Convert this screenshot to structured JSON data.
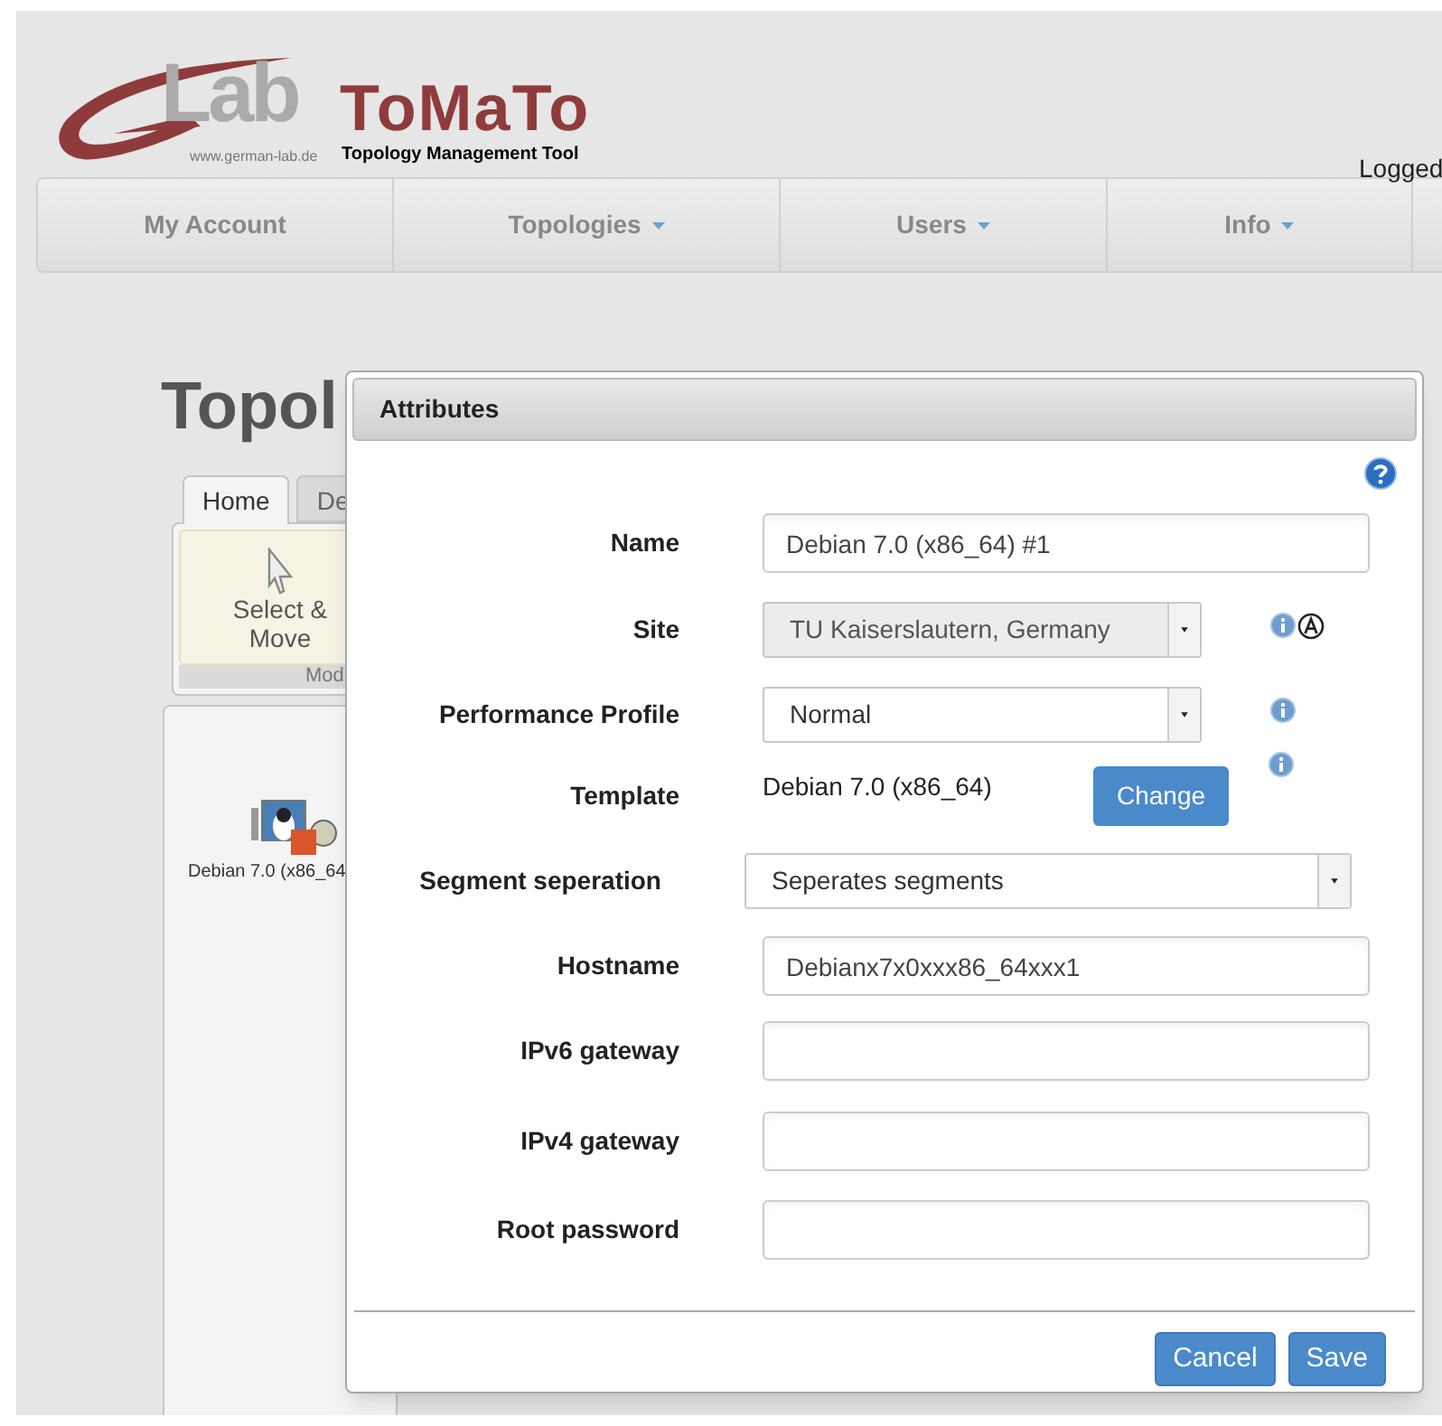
{
  "header": {
    "logo_text": "Lab",
    "logo_url": "www.german-lab.de",
    "app_title": "ToMaTo",
    "app_subtitle": "Topology Management Tool",
    "login_text": "Logged"
  },
  "nav": [
    {
      "label": "My Account",
      "dropdown": false
    },
    {
      "label": "Topologies",
      "dropdown": true
    },
    {
      "label": "Users",
      "dropdown": true
    },
    {
      "label": "Info",
      "dropdown": true
    }
  ],
  "page_title": "Topol",
  "editor_tabs": [
    {
      "label": "Home",
      "selected": true
    },
    {
      "label": "De",
      "selected": false
    }
  ],
  "toolbar": {
    "button": "Select & Move",
    "group_label": "Mod"
  },
  "canvas_node": {
    "label": "Debian 7.0 (x86_64"
  },
  "dialog": {
    "title": "Attributes",
    "fields": [
      {
        "kind": "text",
        "label": "Name",
        "value": "Debian 7.0 (x86_64) #1"
      },
      {
        "kind": "select",
        "label": "Site",
        "value": "TU Kaiserslautern, Germany",
        "disabled": true,
        "wide": false,
        "info": true,
        "auto": true
      },
      {
        "kind": "select",
        "label": "Performance Profile",
        "value": "Normal",
        "disabled": false,
        "wide": false,
        "info": true,
        "auto": false
      },
      {
        "kind": "static",
        "label": "Template",
        "value": "Debian 7.0 (x86_64)",
        "button": "Change",
        "info": true
      },
      {
        "kind": "select",
        "label": "Segment seperation",
        "value": "Seperates segments",
        "disabled": false,
        "wide": true,
        "info": false,
        "auto": false
      },
      {
        "kind": "text",
        "label": "Hostname",
        "value": "Debianx7x0xxx86_64xxx1"
      },
      {
        "kind": "text",
        "label": "IPv6 gateway"
      },
      {
        "kind": "text",
        "label": "IPv4 gateway"
      },
      {
        "kind": "text",
        "label": "Root password"
      }
    ],
    "buttons": [
      "Cancel",
      "Save"
    ]
  }
}
